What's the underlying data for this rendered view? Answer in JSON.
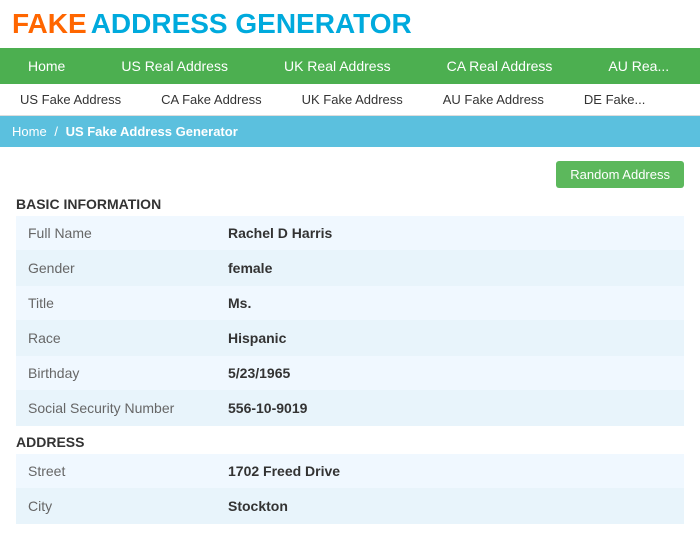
{
  "logo": {
    "fake": "FAKE",
    "rest": "ADDRESS GENERATOR"
  },
  "nav1": {
    "items": [
      {
        "label": "Home",
        "name": "nav1-home"
      },
      {
        "label": "US Real Address",
        "name": "nav1-us-real"
      },
      {
        "label": "UK Real Address",
        "name": "nav1-uk-real"
      },
      {
        "label": "CA Real Address",
        "name": "nav1-ca-real"
      },
      {
        "label": "AU Rea...",
        "name": "nav1-au-real"
      }
    ]
  },
  "nav2": {
    "items": [
      {
        "label": "US Fake Address",
        "name": "nav2-us-fake"
      },
      {
        "label": "CA Fake Address",
        "name": "nav2-ca-fake"
      },
      {
        "label": "UK Fake Address",
        "name": "nav2-uk-fake"
      },
      {
        "label": "AU Fake Address",
        "name": "nav2-au-fake"
      },
      {
        "label": "DE Fake...",
        "name": "nav2-de-fake"
      }
    ]
  },
  "breadcrumb": {
    "home": "Home",
    "separator": "/",
    "current": "US Fake Address Generator"
  },
  "toolbar": {
    "random_button": "Random Address"
  },
  "basic_section": {
    "title": "BASIC INFORMATION",
    "rows": [
      {
        "label": "Full Name",
        "value": "Rachel D Harris"
      },
      {
        "label": "Gender",
        "value": "female"
      },
      {
        "label": "Title",
        "value": "Ms."
      },
      {
        "label": "Race",
        "value": "Hispanic"
      },
      {
        "label": "Birthday",
        "value": "5/23/1965"
      },
      {
        "label": "Social Security Number",
        "value": "556-10-9019"
      }
    ]
  },
  "address_section": {
    "title": "ADDRESS",
    "rows": [
      {
        "label": "Street",
        "value": "1702 Freed Drive"
      },
      {
        "label": "City",
        "value": "Stockton"
      }
    ]
  }
}
